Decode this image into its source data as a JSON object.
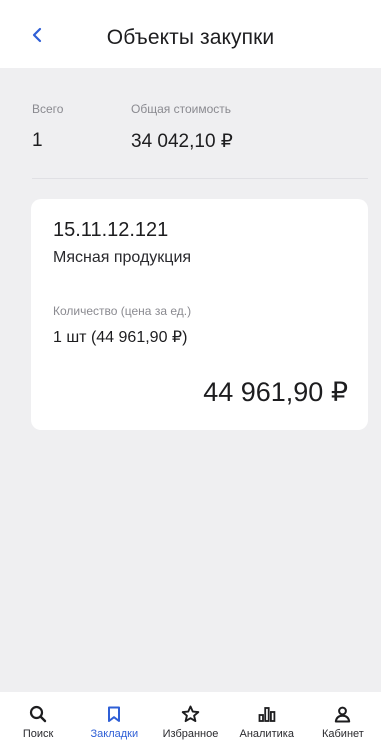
{
  "header": {
    "title": "Объекты закупки",
    "back_icon": "chevron-left-icon"
  },
  "summary": {
    "total_label": "Всего",
    "total_value": "1",
    "cost_label": "Общая стоимость",
    "cost_value": "34 042,10 ₽"
  },
  "item": {
    "code": "15.11.12.121",
    "name": "Мясная продукция",
    "quantity_label": "Количество (цена за ед.)",
    "quantity_value": "1 шт (44 961,90 ₽)",
    "total": "44 961,90 ₽"
  },
  "tabbar": {
    "active": "Закладки",
    "tabs": [
      {
        "label": "Поиск",
        "icon": "search-icon"
      },
      {
        "label": "Закладки",
        "icon": "bookmark-icon"
      },
      {
        "label": "Избранное",
        "icon": "star-icon"
      },
      {
        "label": "Аналитика",
        "icon": "bar-chart-icon"
      },
      {
        "label": "Кабинет",
        "icon": "user-icon"
      }
    ]
  },
  "colors": {
    "accent": "#2f5fd6",
    "background": "#efeff1",
    "card": "#ffffff",
    "muted_text": "#8a8a90"
  }
}
